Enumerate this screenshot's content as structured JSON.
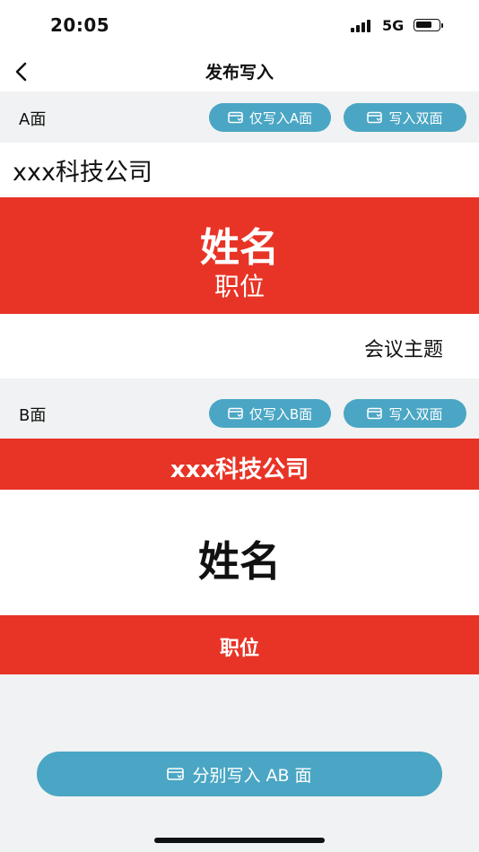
{
  "status_bar": {
    "time": "20:05",
    "network": "5G"
  },
  "nav": {
    "title": "发布写入"
  },
  "side_a": {
    "label": "A面",
    "write_a_label": "仅写入A面",
    "write_both_label": "写入双面",
    "company": "xxx科技公司",
    "name": "姓名",
    "position": "职位",
    "topic": "会议主题"
  },
  "side_b": {
    "label": "B面",
    "write_b_label": "仅写入B面",
    "write_both_label": "写入双面",
    "company": "xxx科技公司",
    "name": "姓名",
    "position": "职位"
  },
  "footer": {
    "write_ab_label": "分别写入 AB 面"
  },
  "colors": {
    "accent": "#4aa6c4",
    "red": "#e83426",
    "background": "#f1f2f3"
  }
}
